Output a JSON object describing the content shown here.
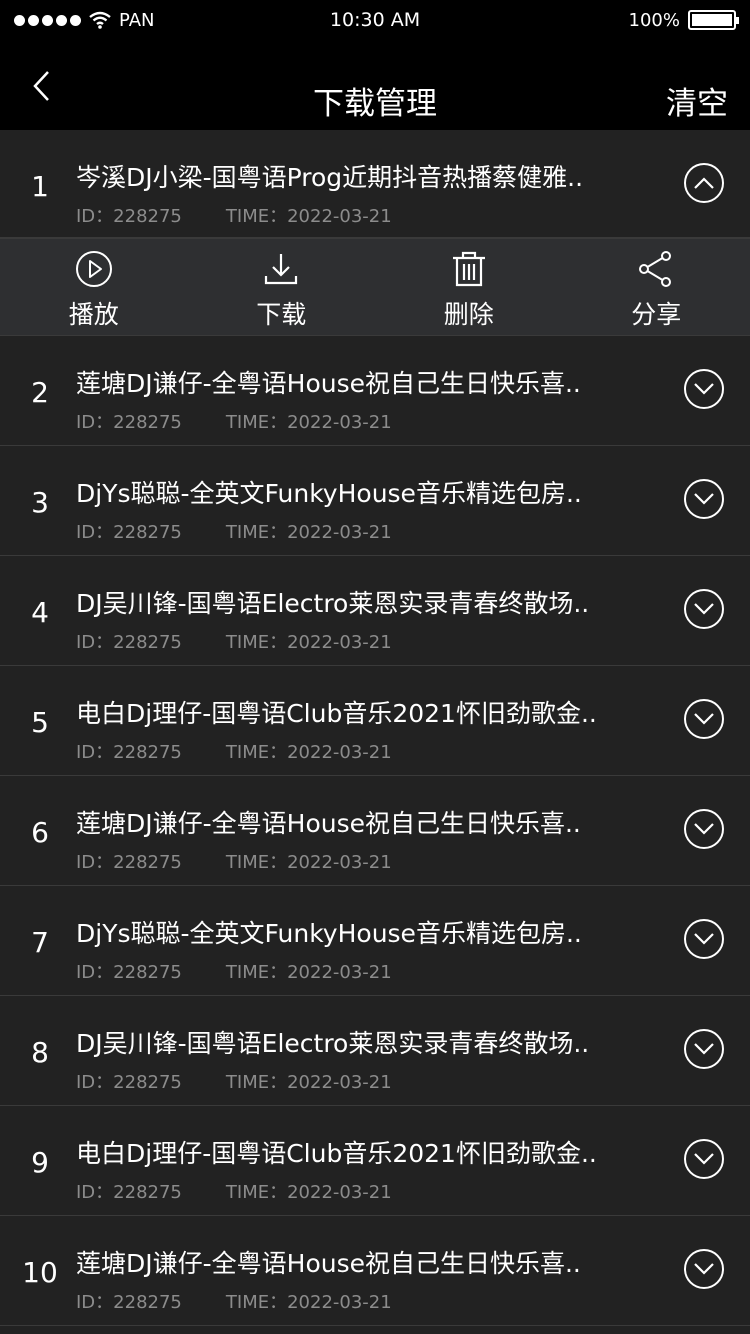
{
  "status_bar": {
    "carrier": "PAN",
    "time": "10:30 AM",
    "battery": "100%"
  },
  "nav": {
    "title": "下载管理",
    "clear_label": "清空"
  },
  "actions": [
    {
      "label": "播放",
      "icon": "play-circle-icon"
    },
    {
      "label": "下载",
      "icon": "download-icon"
    },
    {
      "label": "删除",
      "icon": "trash-icon"
    },
    {
      "label": "分享",
      "icon": "share-icon"
    }
  ],
  "items": [
    {
      "index": "1",
      "title": "岑溪DJ小梁-国粤语Prog近期抖音热播蔡健雅..",
      "id_label": "ID：228275",
      "time_label": "TIME：2022-03-21",
      "expanded": true
    },
    {
      "index": "2",
      "title": "莲塘DJ谦仔-全粤语House祝自己生日快乐喜..",
      "id_label": "ID：228275",
      "time_label": "TIME：2022-03-21"
    },
    {
      "index": "3",
      "title": "DjYs聪聪-全英文FunkyHouse音乐精选包房..",
      "id_label": "ID：228275",
      "time_label": "TIME：2022-03-21"
    },
    {
      "index": "4",
      "title": "DJ吴川锋-国粤语Electro莱恩实录青春终散场..",
      "id_label": "ID：228275",
      "time_label": "TIME：2022-03-21"
    },
    {
      "index": "5",
      "title": "电白Dj理仔-国粤语Club音乐2021怀旧劲歌金..",
      "id_label": "ID：228275",
      "time_label": "TIME：2022-03-21"
    },
    {
      "index": "6",
      "title": "莲塘DJ谦仔-全粤语House祝自己生日快乐喜..",
      "id_label": "ID：228275",
      "time_label": "TIME：2022-03-21"
    },
    {
      "index": "7",
      "title": "DjYs聪聪-全英文FunkyHouse音乐精选包房..",
      "id_label": "ID：228275",
      "time_label": "TIME：2022-03-21"
    },
    {
      "index": "8",
      "title": "DJ吴川锋-国粤语Electro莱恩实录青春终散场..",
      "id_label": "ID：228275",
      "time_label": "TIME：2022-03-21"
    },
    {
      "index": "9",
      "title": "电白Dj理仔-国粤语Club音乐2021怀旧劲歌金..",
      "id_label": "ID：228275",
      "time_label": "TIME：2022-03-21"
    },
    {
      "index": "10",
      "title": "莲塘DJ谦仔-全粤语House祝自己生日快乐喜..",
      "id_label": "ID：228275",
      "time_label": "TIME：2022-03-21"
    }
  ]
}
